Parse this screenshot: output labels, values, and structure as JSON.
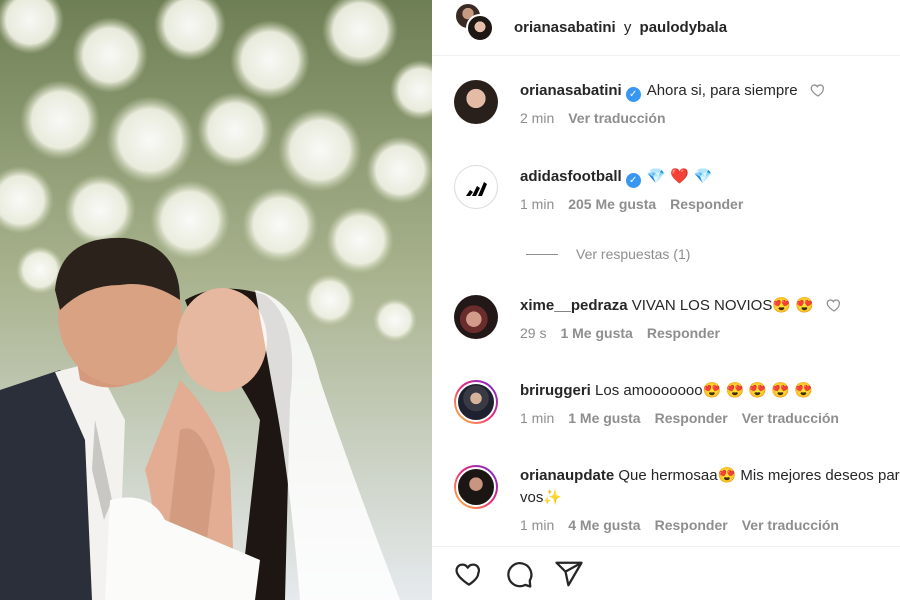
{
  "header": {
    "user_a": "orianasabatini",
    "joiner": "y",
    "user_b": "paulodybala"
  },
  "comments": [
    {
      "username": "orianasabatini",
      "verified": true,
      "text": "Ahora si, para siempre",
      "time": "2 min",
      "likes": "",
      "actions": [
        "Ver traducción"
      ]
    },
    {
      "username": "adidasfootball",
      "verified": true,
      "text": "💎 ❤️ 💎",
      "time": "1 min",
      "likes": "205 Me gusta",
      "actions": [
        "Responder"
      ]
    },
    {
      "username": "xime__pedraza",
      "verified": false,
      "text": "VIVAN LOS NOVIOS😍 😍",
      "time": "29 s",
      "likes": "1 Me gusta",
      "actions": [
        "Responder"
      ]
    },
    {
      "username": "briruggeri",
      "verified": false,
      "text": "Los amooooooo😍 😍 😍 😍 😍",
      "time": "1 min",
      "likes": "1 Me gusta",
      "actions": [
        "Responder",
        "Ver traducción"
      ]
    },
    {
      "username": "orianaupdate",
      "verified": false,
      "text": "Que hermosaa😍  Mis mejores deseos para vos✨",
      "text_line2": "vos✨",
      "time": "1 min",
      "likes": "4 Me gusta",
      "actions": [
        "Responder",
        "Ver traducción"
      ]
    }
  ],
  "replies_link": "Ver respuestas (1)",
  "colors": {
    "verified": "#3897f0",
    "muted": "#8e8e8e",
    "story_ring_start": "#f9ce34",
    "story_ring_end": "#6228d7"
  },
  "icons": [
    "heart-icon",
    "comment-icon",
    "share-icon"
  ]
}
